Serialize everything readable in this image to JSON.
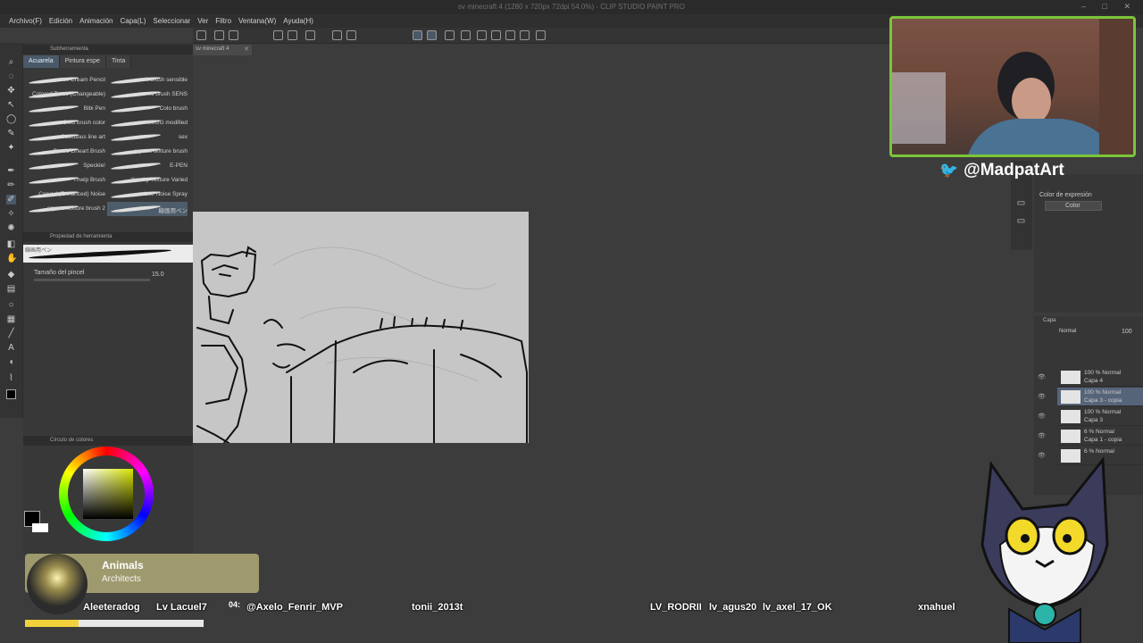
{
  "window": {
    "title": "sv minecraft 4 (1280 x 720px 72dpi 54.0%) - CLIP STUDIO PAINT PRO",
    "controls": "– □ ✕"
  },
  "menu": [
    "Archivo(F)",
    "Edición",
    "Animación",
    "Capa(L)",
    "Seleccionar",
    "Ver",
    "Filtro",
    "Ventana(W)",
    "Ayuda(H)"
  ],
  "doc_tab": {
    "label": "sv minecraft 4",
    "close": "✕"
  },
  "subtool_panel": {
    "header": "Subherramienta",
    "tabs": [
      "Acuarela",
      "Pintura espe",
      "Tinta"
    ],
    "active_tab": 0,
    "brushes": [
      [
        "Ice Cream Pencil",
        "Ili brush sensible"
      ],
      [
        "Colored Trees (Changeable)",
        "Ili brush SENS"
      ],
      [
        "Bibi Pen",
        "Colo brush"
      ],
      [
        "Gold brush color",
        "HIMGG modified"
      ],
      [
        "Succubus line art",
        "sex"
      ],
      [
        "Comic Lineart Brush",
        "square texture brush"
      ],
      [
        "Speckle!",
        "E-PEN"
      ],
      [
        "Thwip Brush",
        "Kracky Texture Varied"
      ],
      [
        "Carved (Enhanced) Noise",
        "Line Noise Spray"
      ],
      [
        "square texture brush 2",
        "線画用ペン"
      ]
    ],
    "selected_brush": "線画用ペン"
  },
  "tool_property": {
    "header": "Propiedad de herramienta",
    "preview_label": "線画用ペン",
    "size_label": "Tamaño del pincel",
    "size_value": "15.0"
  },
  "color_panel": {
    "header": "Círculo de colores",
    "fg_color": "#000000",
    "bg_color": "#ffffff"
  },
  "expression_panel": {
    "label": "Color de expresión",
    "value": "Color"
  },
  "layer_panel": {
    "tab": "Capa",
    "blend_mode": "Normal",
    "opacity": "100",
    "layers": [
      {
        "mode": "100 % Normal",
        "name": "Capa 4",
        "selected": false
      },
      {
        "mode": "100 % Normal",
        "name": "Capa 3 - copia",
        "selected": true
      },
      {
        "mode": "100 % Normal",
        "name": "Capa 3",
        "selected": false
      },
      {
        "mode": "6 % Normal",
        "name": "Capa 1 - copia",
        "selected": false
      },
      {
        "mode": "6 % Normal",
        "name": "",
        "selected": false
      }
    ]
  },
  "overlay": {
    "twitter_handle": "@MadpatArt",
    "music": {
      "title": "Animals",
      "artist": "Architects",
      "time": "04:"
    },
    "chat_names": [
      "Aleeteradog",
      "Lv Lacuel7",
      "@Axelo_Fenrir_MVP",
      "tonii_2013t",
      "LV_RODRII",
      "lv_agus20",
      "lv_axel_17_OK",
      "xnahuel"
    ]
  },
  "colors": {
    "accent_green": "#7bc53a",
    "twitter_blue": "#1d9bf0",
    "selected_tab": "#4a5968"
  }
}
